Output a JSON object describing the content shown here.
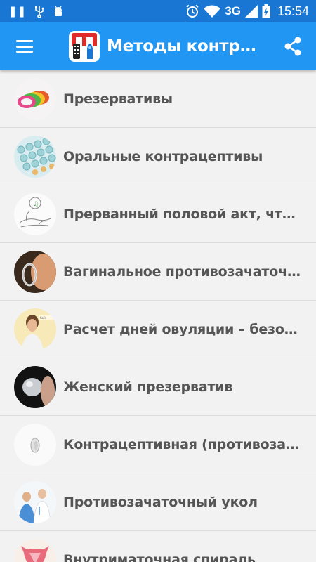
{
  "status_bar": {
    "icons": [
      "pause-icon",
      "usb-icon",
      "android-icon",
      "alarm-icon",
      "wifi-icon",
      "signal-icon",
      "battery-icon"
    ],
    "network": "3G",
    "time": "15:54"
  },
  "app_bar": {
    "title": "Методы контрацептивов",
    "menu_icon": "hamburger-menu-icon",
    "share_icon": "share-icon",
    "color": "#2196f3",
    "status_color": "#1976d2"
  },
  "items": [
    {
      "label": "Презервативы",
      "icon": "condoms-thumbnail"
    },
    {
      "label": "Оральные контрацептивы",
      "icon": "pills-thumbnail"
    },
    {
      "label": "Прерванный половой акт, что нужно знать",
      "icon": "sketch-thumbnail"
    },
    {
      "label": "Вагинальное противозачаточное кольцо",
      "icon": "ring-thumbnail"
    },
    {
      "label": "Расчет дней овуляции – безопасные дни",
      "icon": "woman-thumbnail"
    },
    {
      "label": "Женский презерватив",
      "icon": "female-condom-thumbnail"
    },
    {
      "label": "Контрацептивная (противозачаточная) губка",
      "icon": "sponge-thumbnail"
    },
    {
      "label": "Противозачаточный укол",
      "icon": "doctor-thumbnail"
    },
    {
      "label": "Внутриматочная спираль",
      "icon": "uterus-thumbnail"
    }
  ]
}
